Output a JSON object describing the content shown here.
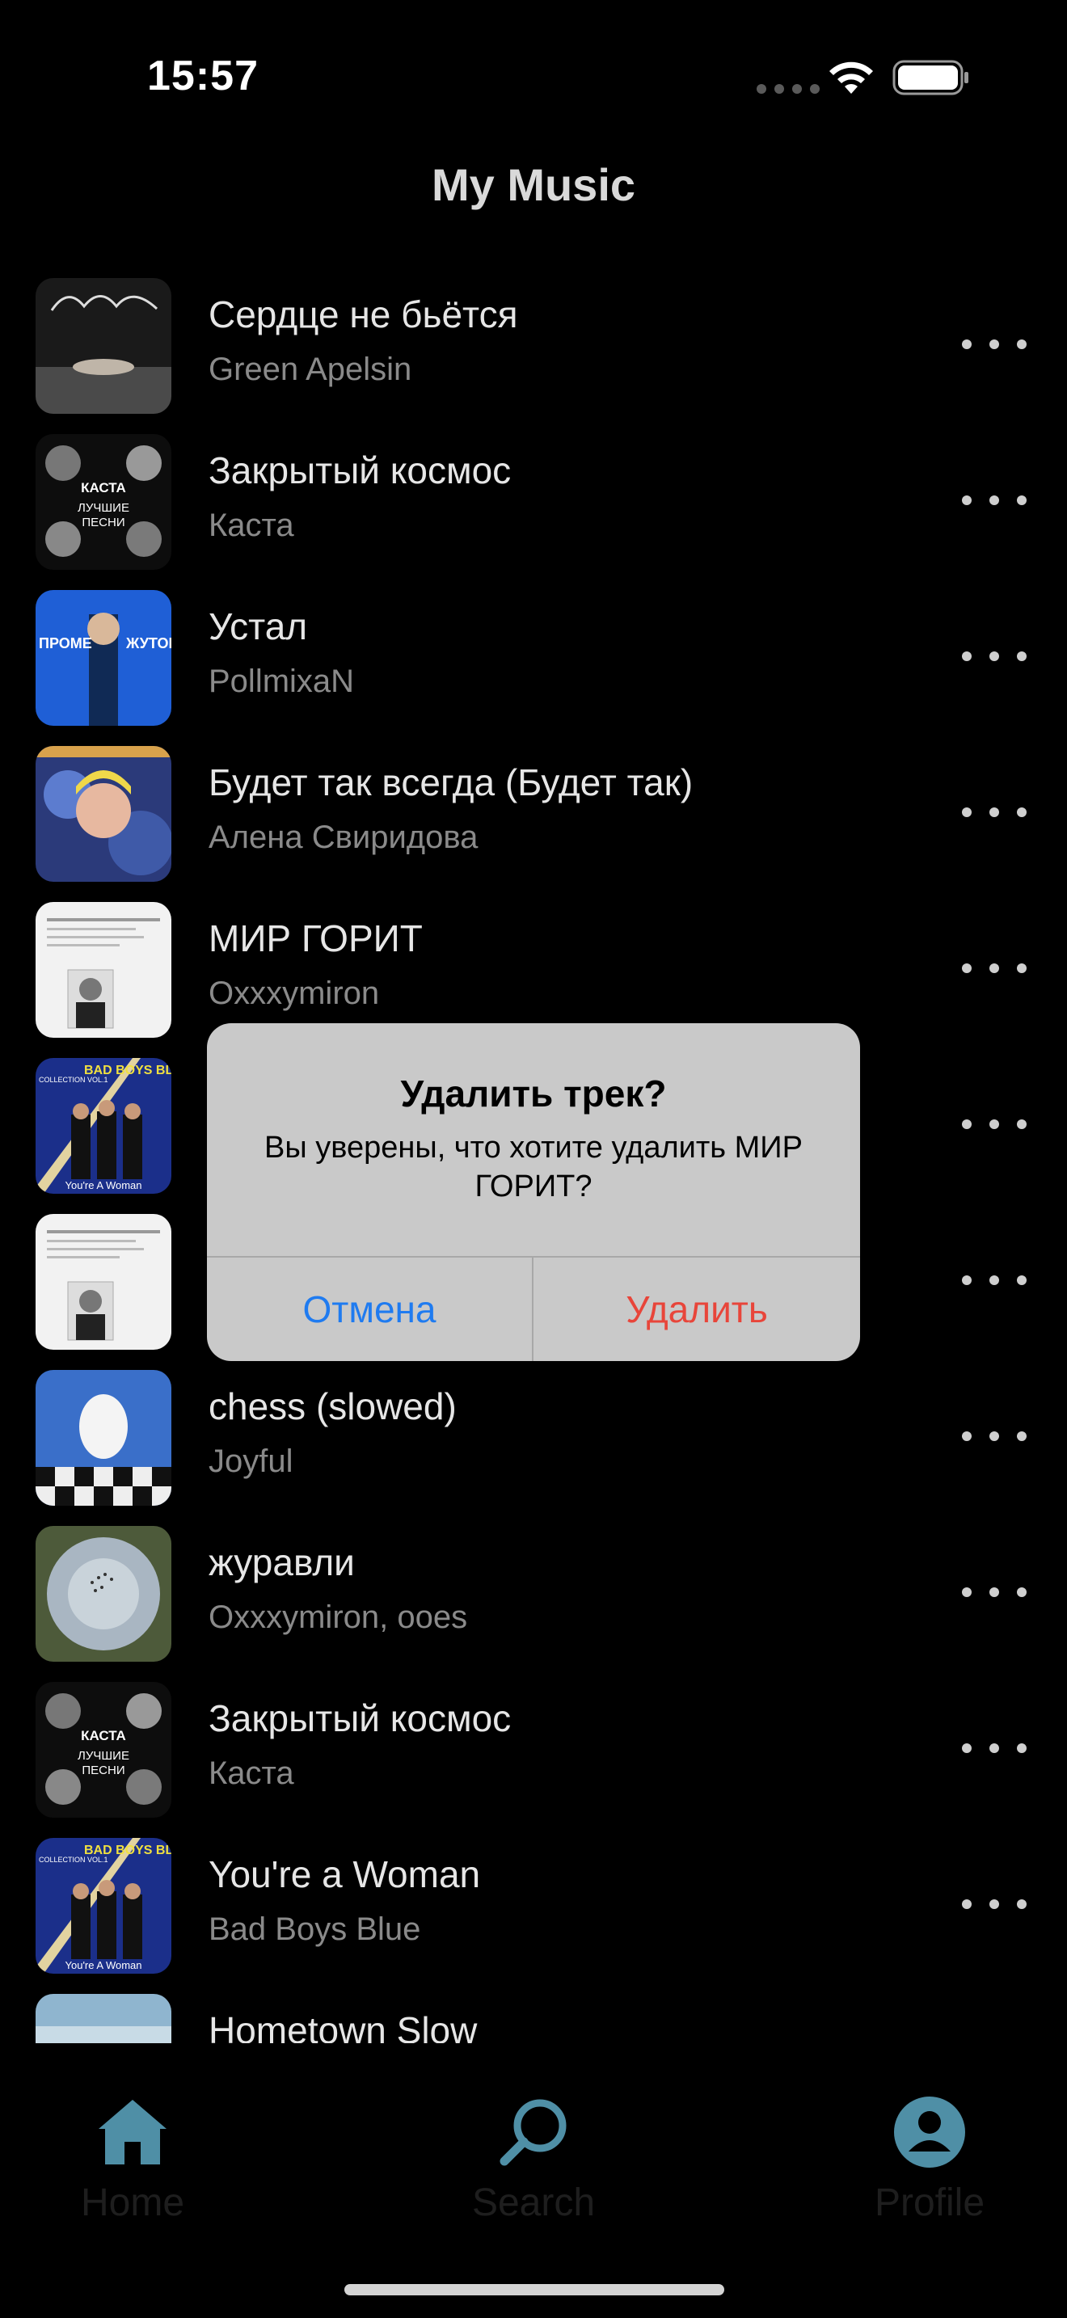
{
  "status_bar": {
    "time": "15:57"
  },
  "header": {
    "title": "My Music"
  },
  "tracks": [
    {
      "title": "Сердце не бьётся",
      "artist": "Green Apelsin",
      "cover": "opyum-cover"
    },
    {
      "title": "Закрытый космос",
      "artist": "Каста",
      "cover": "kasta-cover"
    },
    {
      "title": "Устал",
      "artist": "PollmixaN",
      "cover": "blue-portrait-cover"
    },
    {
      "title": "Будет так всегда (Будет так)",
      "artist": "Алена Свиридова",
      "cover": "sviridova-cover"
    },
    {
      "title": "МИР ГОРИТ",
      "artist": "Oxxxymiron",
      "cover": "document-cover"
    },
    {
      "title": "",
      "artist": "",
      "cover": "bad-boys-blue-cover"
    },
    {
      "title": "",
      "artist": "",
      "cover": "document-cover"
    },
    {
      "title": "chess (slowed)",
      "artist": "Joyful",
      "cover": "chess-cover"
    },
    {
      "title": "журавли",
      "artist": "Oxxxymiron, ooes",
      "cover": "sky-cover"
    },
    {
      "title": "Закрытый космос",
      "artist": "Каста",
      "cover": "kasta-cover"
    },
    {
      "title": "You're a Woman",
      "artist": "Bad Boys Blue",
      "cover": "bad-boys-blue-cover"
    },
    {
      "title": "Hometown Slow",
      "artist": "",
      "cover": "sky-cover"
    }
  ],
  "cover_text": {
    "kasta_name": "КАСТА",
    "kasta_sub1": "ЛУЧШИЕ",
    "kasta_sub2": "ПЕСНИ",
    "bbb_top": "BAD BOYS BLUE",
    "bbb_collection": "COLLECTION VOL.1",
    "bbb_bottom": "You're A Woman",
    "blue_left": "ПРОМЕ",
    "blue_right": "ЖУТОК"
  },
  "alert": {
    "title": "Удалить трек?",
    "message": "Вы уверены, что хотите удалить МИР ГОРИТ?",
    "cancel_label": "Отмена",
    "delete_label": "Удалить"
  },
  "tab_bar": {
    "items": [
      {
        "label": "Home",
        "icon": "home-icon"
      },
      {
        "label": "Search",
        "icon": "search-icon"
      },
      {
        "label": "Profile",
        "icon": "profile-icon"
      }
    ]
  },
  "colors": {
    "background": "#000000",
    "title_text": "#e6e6e6",
    "subtitle_text": "#8a8a8a",
    "alert_bg": "#c9c9c9",
    "cancel_blue": "#1f7bf0",
    "delete_red": "#e8453a",
    "tab_icon": "#4f8fa6"
  }
}
